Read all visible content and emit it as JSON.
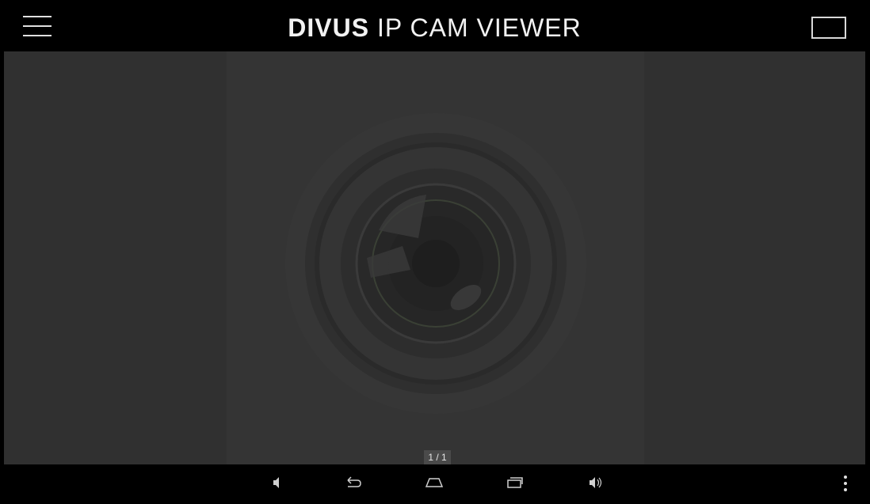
{
  "header": {
    "title_brand": "DIVUS",
    "title_rest": " IP CAM VIEWER",
    "menu_icon": "hamburger-menu-icon",
    "window_icon": "window-toggle-icon"
  },
  "viewer": {
    "placeholder_icon": "camera-lens-icon",
    "pager_text": "1 / 1"
  },
  "navbar": {
    "icons": [
      "volume-down-icon",
      "back-icon",
      "home-icon",
      "recent-apps-icon",
      "volume-up-icon",
      "overflow-menu-icon"
    ]
  },
  "colors": {
    "background": "#2f2f2f",
    "bars": "#000000",
    "text": "#f2f2f2"
  }
}
